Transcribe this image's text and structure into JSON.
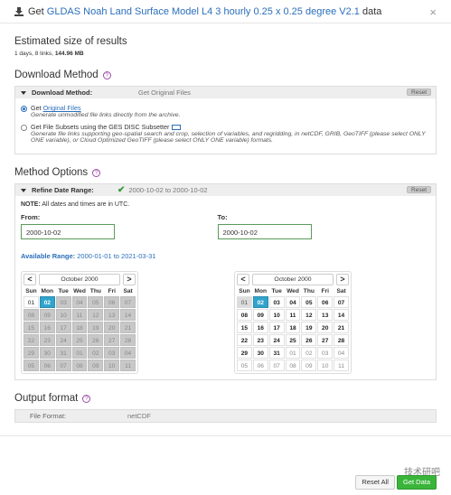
{
  "header": {
    "prefix": "Get",
    "link_text": "GLDAS Noah Land Surface Model L4 3 hourly 0.25 x 0.25 degree V2.1",
    "suffix": "data",
    "close": "×"
  },
  "estimate": {
    "title": "Estimated size of results",
    "summary_prefix": "1 days, 8 links, ",
    "size": "144.96 MB"
  },
  "download": {
    "title": "Download Method",
    "panel_label": "Download Method:",
    "panel_value": "Get Original Files",
    "reset": "Reset",
    "options": [
      {
        "pre": "Get ",
        "link": "Original Files",
        "desc": "Generate unmodified file links directly from the archive.",
        "selected": true
      },
      {
        "pre": "Get File Subsets using the GES DISC Subsetter",
        "link": "",
        "desc": "Generate file links supporting geo-spatial search and crop, selection of variables, and regridding, in netCDF, GRIB, GeoTIFF (please select ONLY ONE variable), or Cloud Optimized GeoTIFF (please select ONLY ONE variable) formats.",
        "selected": false
      }
    ]
  },
  "method": {
    "title": "Method Options",
    "panel_label": "Refine Date Range:",
    "panel_value": "2000-10-02 to 2000-10-02",
    "reset": "Reset",
    "note_label": "NOTE:",
    "note_text": " All dates and times are in UTC.",
    "from_label": "From:",
    "from_value": "2000-10-02",
    "to_label": "To:",
    "to_value": "2000-10-02",
    "avail_label": "Available Range:",
    "avail_value": " 2000-01-01 to 2021-03-31"
  },
  "calendar": {
    "month": "October 2000",
    "prev": "<",
    "next": ">",
    "weekdays": [
      "Sun",
      "Mon",
      "Tue",
      "Wed",
      "Thu",
      "Fri",
      "Sat"
    ],
    "weeks": [
      [
        "01",
        "02",
        "03",
        "04",
        "05",
        "06",
        "07"
      ],
      [
        "08",
        "09",
        "10",
        "11",
        "12",
        "13",
        "14"
      ],
      [
        "15",
        "16",
        "17",
        "18",
        "19",
        "20",
        "21"
      ],
      [
        "22",
        "23",
        "24",
        "25",
        "26",
        "27",
        "28"
      ],
      [
        "29",
        "30",
        "31",
        "01",
        "02",
        "03",
        "04"
      ],
      [
        "05",
        "06",
        "07",
        "08",
        "09",
        "10",
        "11"
      ]
    ]
  },
  "output": {
    "title": "Output format",
    "label": "File Format:",
    "value": "netCDF"
  },
  "buttons": {
    "reset_all": "Reset All",
    "get_data": "Get Data"
  },
  "watermark": "技术研吧"
}
